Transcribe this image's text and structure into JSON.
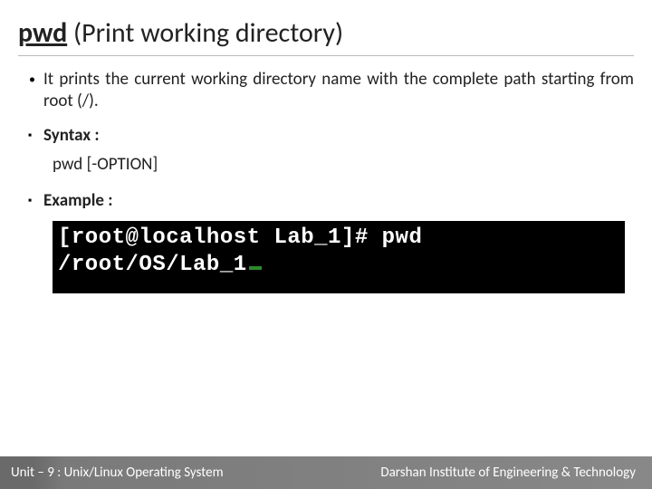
{
  "title": {
    "command": "pwd",
    "description": "(Print working directory)"
  },
  "bullets": {
    "item1": "It prints the current working directory name with the complete path starting from root (/).",
    "item2_label": "Syntax :",
    "item2_body": "pwd [-OPTION]",
    "item3_label": "Example :"
  },
  "terminal": {
    "line1": "[root@localhost Lab_1]# pwd",
    "line2": "/root/OS/Lab_1"
  },
  "footer": {
    "left": "Unit – 9  : Unix/Linux Operating System",
    "right": "Darshan Institute of Engineering & Technology"
  }
}
